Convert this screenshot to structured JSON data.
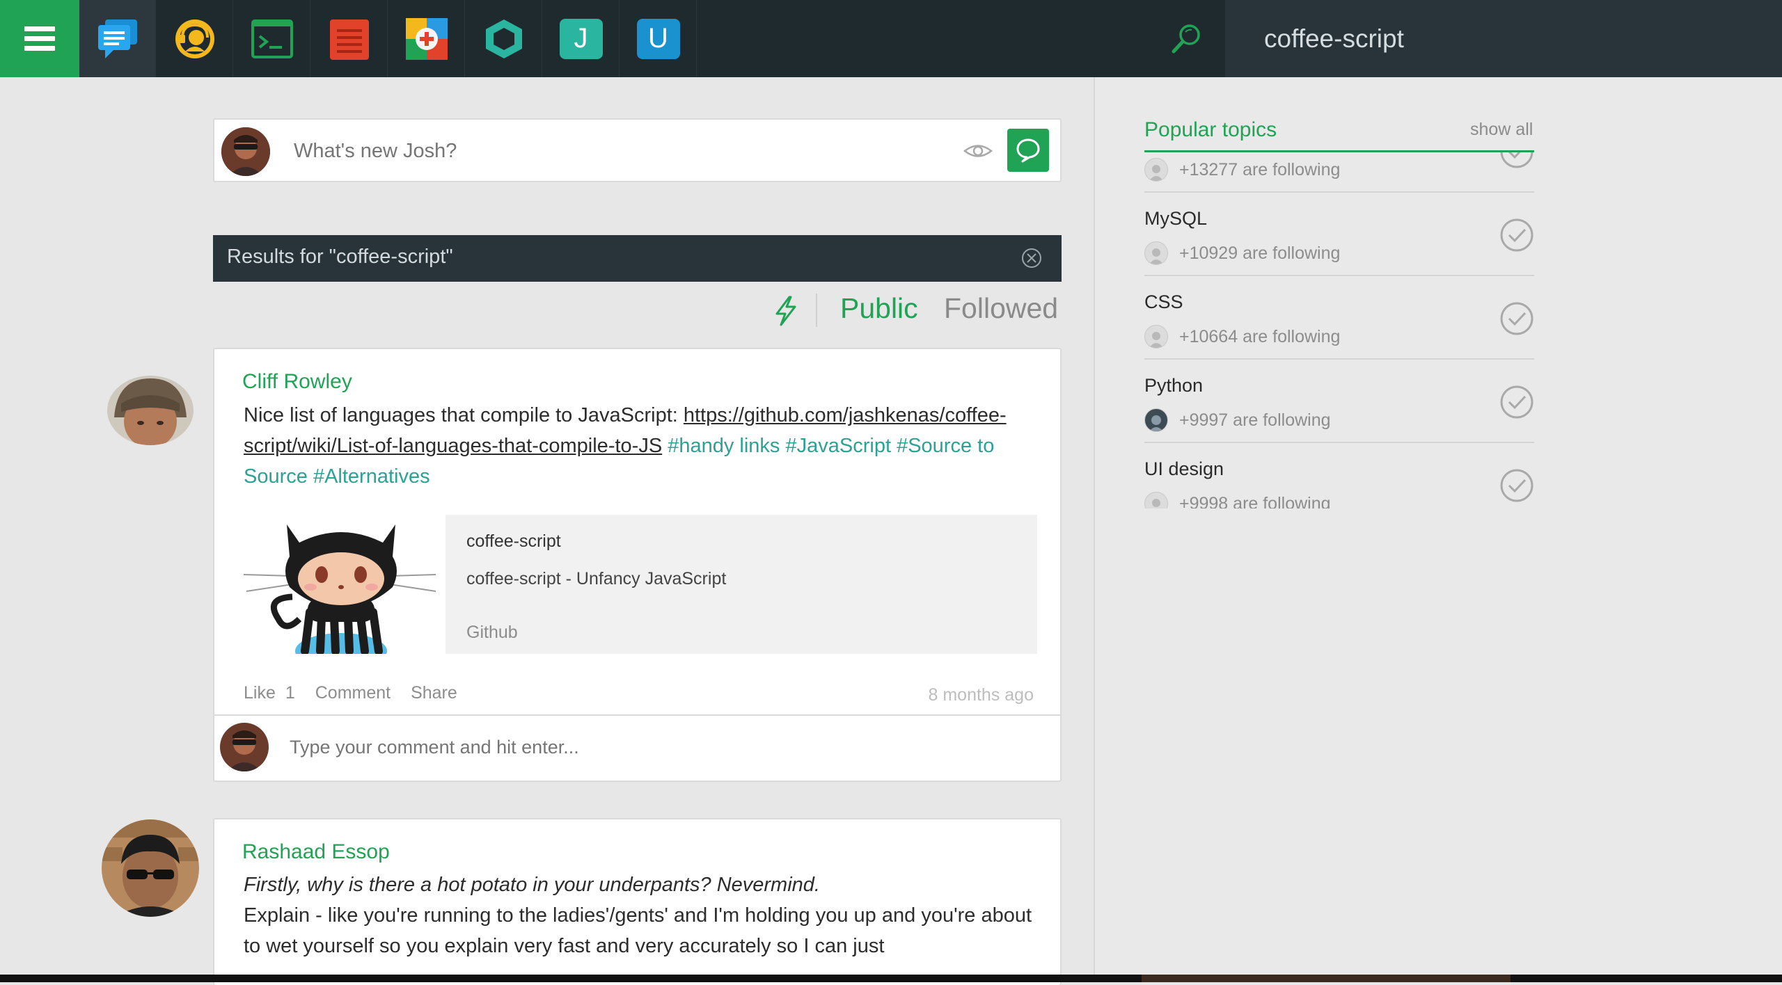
{
  "topbar": {
    "apps": [
      {
        "name": "messages-app",
        "letter": ""
      },
      {
        "name": "support-app",
        "letter": ""
      },
      {
        "name": "terminal-app",
        "letter": ""
      },
      {
        "name": "notes-app",
        "letter": ""
      },
      {
        "name": "medical-app",
        "letter": ""
      },
      {
        "name": "hexagon-app",
        "letter": ""
      },
      {
        "name": "j-app",
        "letter": "J"
      },
      {
        "name": "u-app",
        "letter": "U"
      }
    ],
    "search_value": "coffee-script"
  },
  "composer": {
    "placeholder": "What's new Josh?"
  },
  "results": {
    "label": "Results for \"coffee-script\""
  },
  "filters": {
    "public": "Public",
    "followed": "Followed"
  },
  "posts": [
    {
      "author": "Cliff Rowley",
      "text_prefix": "Nice list of languages that compile to JavaScript: ",
      "url": "https://github.com/jashkenas/coffee-script/wiki/List-of-languages-that-compile-to-JS",
      "tags": [
        "#handy links",
        "#JavaScript",
        "#Source to Source",
        "#Alternatives"
      ],
      "preview": {
        "title": "coffee-script",
        "description": "coffee-script - Unfancy JavaScript",
        "source": "Github"
      },
      "like_label": "Like",
      "like_count": "1",
      "comment_label": "Comment",
      "share_label": "Share",
      "time": "8 months ago",
      "comment_placeholder": "Type your comment and hit enter..."
    },
    {
      "author": "Rashaad Essop",
      "italic_line": "Firstly, why is there a hot potato in your underpants? Nevermind.",
      "text": "Explain - like you're running to the ladies'/gents' and I'm holding you up and you're about to wet yourself so you explain very fast and very accurately so I can just"
    }
  ],
  "sidebar": {
    "title": "Popular topics",
    "show_all": "show all",
    "topics": [
      {
        "name": "",
        "following": "+13277 are following"
      },
      {
        "name": "MySQL",
        "following": "+10929 are following"
      },
      {
        "name": "CSS",
        "following": "+10664 are following"
      },
      {
        "name": "Python",
        "following": "+9997 are following"
      },
      {
        "name": "UI design",
        "following": "+9998 are following"
      }
    ]
  },
  "colors": {
    "accent": "#21a355",
    "topbar": "#1f2a2e",
    "tag": "#2aa394"
  }
}
